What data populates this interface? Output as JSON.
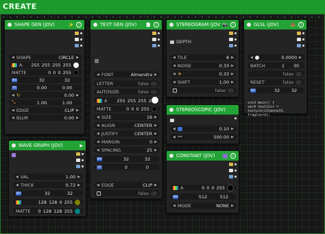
{
  "banner": "CREATE",
  "shape": {
    "title": "SHAPE GEN (JOV)",
    "emoji": "✨",
    "rows": {
      "shape_label": "SHAPE",
      "shape_val": "CIRCLE",
      "rgba": [
        "255",
        "255",
        "255",
        "255"
      ],
      "matte_label": "MATTE",
      "matte": [
        "0",
        "0",
        "0",
        "255"
      ],
      "wh": [
        "32",
        "32"
      ],
      "xy": [
        "0.00",
        "0.00"
      ],
      "angle": "0.00",
      "size": [
        "1.00",
        "1.00"
      ],
      "edge_label": "EDGE",
      "edge_val": "CLIP",
      "blur_label": "BLUR",
      "blur_val": "0.00"
    },
    "colors": {
      "rgba": "#ffffff",
      "matte": "#000000"
    }
  },
  "text": {
    "title": "TEXT GEN (JOV)",
    "emoji": "📄",
    "rows": {
      "font_label": "FONT",
      "font_val": "Almendra",
      "letter_label": "LETTER",
      "letter_val": "false",
      "autosize_label": "AUTOSIZE",
      "autosize_val": "false",
      "rgba": [
        "255",
        "255",
        "255",
        "255"
      ],
      "matte_label": "MATTE",
      "matte": [
        "0",
        "0",
        "0",
        "255"
      ],
      "size_label": "SIZE",
      "size_val": "16",
      "align_label": "ALIGN",
      "align_val": "CENTER",
      "justify_label": "JUSTIFY",
      "justify_val": "CENTER",
      "margin_label": "MARGIN",
      "margin_val": "0",
      "spacing_label": "SPACING",
      "spacing_val": "25",
      "wh": [
        "32",
        "32"
      ],
      "xy": [
        "0",
        "0"
      ],
      "edge_label": "EDGE",
      "edge_val": "CLIP",
      "invert_val": "false"
    }
  },
  "stereogram": {
    "title": "STEREOGRAM (JOV)",
    "emoji": "📷",
    "rows": {
      "depth_label": "DEPTH",
      "tile_label": "TILE",
      "tile_val": "8",
      "noise_label": "NOISE",
      "noise_val": "0.33",
      "gamma_val": "0.33",
      "shift_label": "SHIFT",
      "shift_val": "1.00",
      "invert_val": "false"
    }
  },
  "glsl": {
    "title": "GLSL (JOV)",
    "emoji": "🍩",
    "rows": {
      "time_val": "0.0000",
      "batch_label": "BATCH",
      "batch": [
        "1",
        "30"
      ],
      "reset_label": "RESET",
      "reset_val": "false",
      "wait_val": "false",
      "wh": [
        "32",
        "32"
      ]
    },
    "code": [
      "void main() {",
      "    vec4 texColor =",
      "    texture(iChannel0, fragCoord);"
    ]
  },
  "stereoscopic": {
    "title": "STEREOSCOPIC (JOV)",
    "rows": {
      "interocular": "0.10",
      "focal": "500.00"
    }
  },
  "constant": {
    "title": "CONSTANT (JOV)",
    "rows": {
      "rgba": [
        "0",
        "0",
        "0",
        "255"
      ],
      "wh": [
        "512",
        "512"
      ],
      "mode_label": "MODE",
      "mode_val": "NONE"
    },
    "colors": {
      "swatch": "#000000"
    }
  },
  "wave": {
    "title": "WAVE GRAPH (JOV)",
    "emoji": "▶",
    "rows": {
      "val_label": "VAL",
      "val": "1.00",
      "thick_label": "THICK",
      "thick": "0.72",
      "wh": [
        "32",
        "32"
      ],
      "rgba": [
        "128",
        "128",
        "0",
        "255"
      ],
      "matte_label": "MATTE",
      "matte": [
        "0",
        "128",
        "128",
        "255"
      ]
    },
    "colors": {
      "rgba": "#808000",
      "matte": "#008080"
    }
  }
}
